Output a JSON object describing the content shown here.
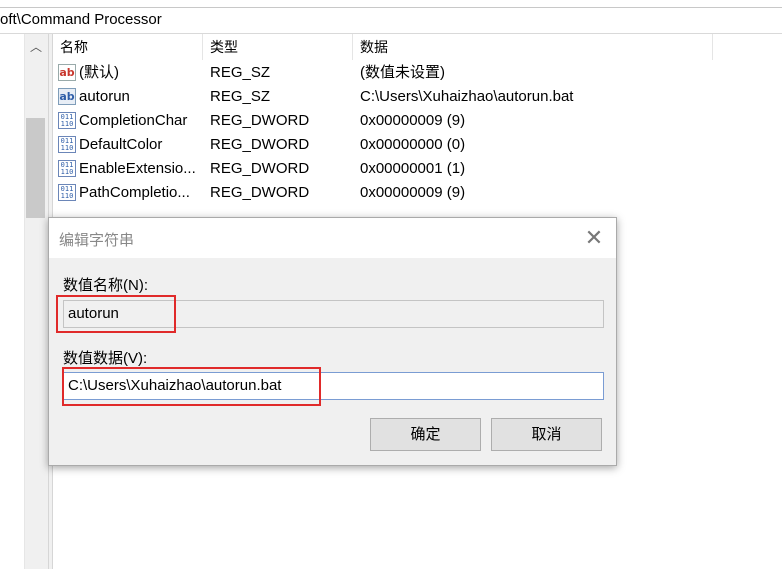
{
  "address": {
    "path": "oft\\Command Processor"
  },
  "columns": {
    "name": "名称",
    "type": "类型",
    "data": "数据"
  },
  "rows": [
    {
      "icon": "string-value-icon",
      "name": "(默认)",
      "type": "REG_SZ",
      "data": "(数值未设置)"
    },
    {
      "icon": "string-value-icon",
      "name": "autorun",
      "type": "REG_SZ",
      "data": "C:\\Users\\Xuhaizhao\\autorun.bat"
    },
    {
      "icon": "binary-value-icon",
      "name": "CompletionChar",
      "type": "REG_DWORD",
      "data": "0x00000009 (9)"
    },
    {
      "icon": "binary-value-icon",
      "name": "DefaultColor",
      "type": "REG_DWORD",
      "data": "0x00000000 (0)"
    },
    {
      "icon": "binary-value-icon",
      "name": "EnableExtensio...",
      "type": "REG_DWORD",
      "data": "0x00000001 (1)"
    },
    {
      "icon": "binary-value-icon",
      "name": "PathCompletio...",
      "type": "REG_DWORD",
      "data": "0x00000009 (9)"
    }
  ],
  "icons": {
    "string": "ab",
    "binary": "011\n110"
  },
  "dialog": {
    "title": "编辑字符串",
    "name_label": "数值名称(N):",
    "name_value": "autorun",
    "data_label": "数值数据(V):",
    "data_value": "C:\\Users\\Xuhaizhao\\autorun.bat",
    "ok_label": "确定",
    "cancel_label": "取消",
    "close_glyph": "✕"
  },
  "colors": {
    "highlight": "#e02a2a",
    "accent": "#7a9cd3"
  }
}
